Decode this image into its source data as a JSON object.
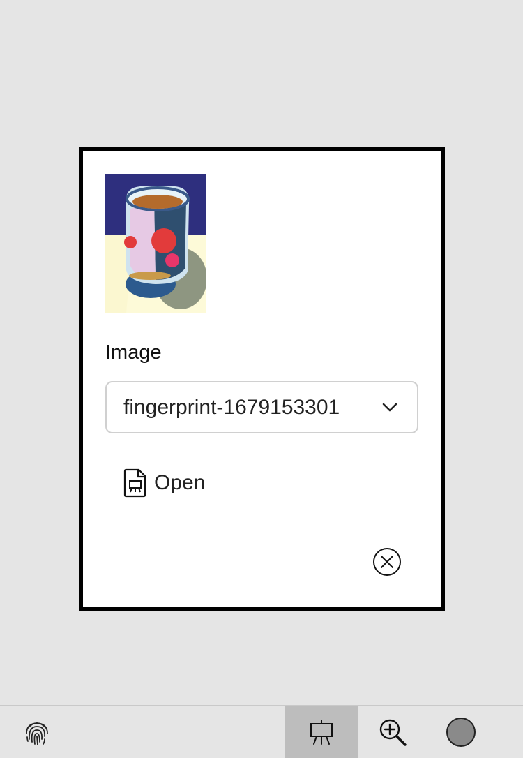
{
  "dialog": {
    "image_alt": "Painting of a glass jar",
    "field_label": "Image",
    "selected_image": "fingerprint-1679153301",
    "open_label": "Open"
  },
  "icons": {
    "file": "file-image-icon",
    "chevron": "chevron-down-icon",
    "close": "close-circle-icon",
    "fingerprint": "fingerprint-icon",
    "easel": "easel-icon",
    "zoom": "zoom-in-icon"
  },
  "toolbar": {
    "active_tab": "easel"
  },
  "colors": {
    "background": "#e5e5e5",
    "dialog_border": "#000000",
    "active_tab": "#bdbdbd",
    "avatar": "#8a8a8a"
  }
}
